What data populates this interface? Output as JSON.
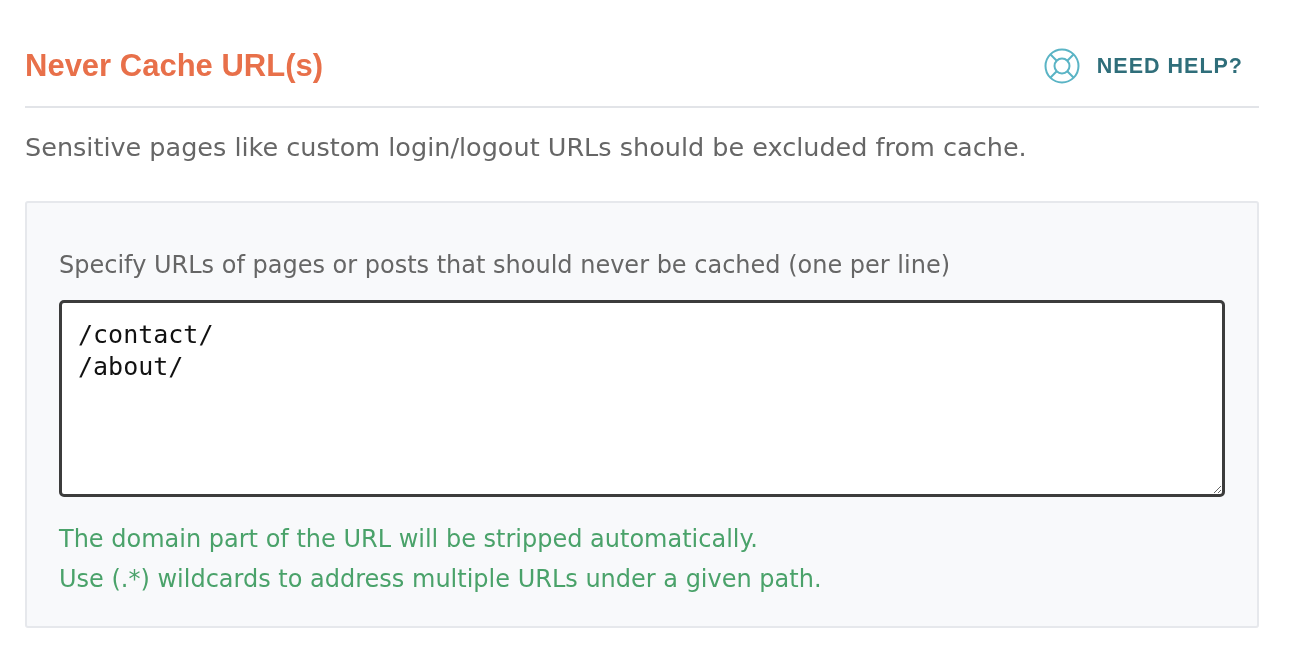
{
  "section": {
    "title": "Never Cache URL(s)",
    "help_link": "NEED HELP?",
    "description": "Sensitive pages like custom login/logout URLs should be excluded from cache."
  },
  "panel": {
    "field_label": "Specify URLs of pages or posts that should never be cached (one per line)",
    "field": {
      "value": "/contact/\n/about/"
    },
    "notes": [
      "The domain part of the URL will be stripped automatically.",
      "Use (.*) wildcards to address multiple URLs under a given path."
    ]
  }
}
